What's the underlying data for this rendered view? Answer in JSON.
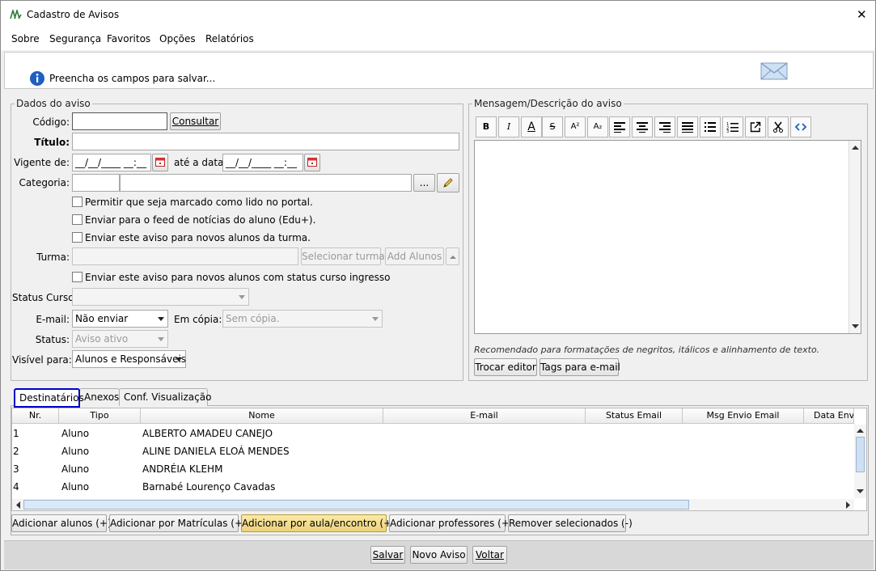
{
  "window": {
    "title": "Cadastro de Avisos",
    "close_glyph": "✕"
  },
  "menu": [
    "Sobre",
    "Segurança",
    "Favoritos",
    "Opções",
    "Relatórios"
  ],
  "info": {
    "text": "Preencha os campos para salvar...",
    "icon": "info-icon",
    "mail_icon": "envelope-icon"
  },
  "dados": {
    "legend": "Dados do aviso",
    "codigo_label": "Código:",
    "codigo_value": "",
    "consultar": "Consultar",
    "titulo_label": "Título:",
    "titulo_value": "",
    "vigente_label": "Vigente de:",
    "vigente_value": "__/__/____ __:__",
    "ate_label": "até a data:",
    "ate_value": "__/__/____ __:__",
    "categoria_label": "Categoria:",
    "categoria_browse": "...",
    "check1": "Permitir que seja marcado como lido no portal.",
    "check2": "Enviar para o feed de notícias do aluno (Edu+).",
    "check3": "Enviar este aviso para novos alunos da turma.",
    "turma_label": "Turma:",
    "selecionar_turma": "Selecionar turma",
    "add_alunos": "Add Alunos",
    "check4": "Enviar este aviso para novos alunos com status curso ingresso",
    "status_curso_label": "Status Curso:",
    "status_curso_value": "",
    "email_label": "E-mail:",
    "email_value": "Não enviar",
    "em_copia_label": "Em cópia:",
    "em_copia_placeholder": "Sem cópia.",
    "status_label": "Status:",
    "status_value": "Aviso ativo",
    "visivel_label": "Visível para:",
    "visivel_value": "Alunos e Responsáveis"
  },
  "mensagem": {
    "legend": "Mensagem/Descrição do aviso",
    "toolbar": [
      "B",
      "I",
      "A",
      "S",
      "A²",
      "A₂",
      "align-left-icon",
      "align-center-icon",
      "align-right-icon",
      "justify-icon",
      "bullet-list-icon",
      "numbered-list-icon",
      "external-link-icon",
      "cut-icon",
      "code-icon"
    ],
    "hint": "Recomendado para formatações de negritos, itálicos e alinhamento de texto.",
    "trocar_editor": "Trocar editor",
    "tags_email": "Tags para e-mail"
  },
  "tabs": [
    "Destinatários",
    "Anexos",
    "Conf. Visualização"
  ],
  "grid": {
    "columns": [
      "Nr.",
      "Tipo",
      "Nome",
      "E-mail",
      "Status Email",
      "Msg Envio Email",
      "Data Envio"
    ],
    "rows": [
      [
        "1",
        "Aluno",
        "ALBERTO AMADEU CANEJO",
        "",
        "",
        "",
        ""
      ],
      [
        "2",
        "Aluno",
        "ALINE DANIELA ELOÁ MENDES",
        "",
        "",
        "",
        ""
      ],
      [
        "3",
        "Aluno",
        "ANDRÉIA KLEHM",
        "",
        "",
        "",
        ""
      ],
      [
        "4",
        "Aluno",
        "Barnabé Lourenço Cavadas",
        "",
        "",
        "",
        ""
      ]
    ]
  },
  "grid_buttons": [
    "Adicionar alunos (+)",
    "Adicionar por Matrículas (+)",
    "Adicionar por aula/encontro (+)",
    "Adicionar professores (+)",
    "Remover selecionados (-)"
  ],
  "footer": [
    "Salvar",
    "Novo Aviso",
    "Voltar"
  ],
  "colors": {
    "accent": "#0000cc",
    "highlight_button": "#f2dc8c",
    "info_blue": "#1f5fbf"
  }
}
